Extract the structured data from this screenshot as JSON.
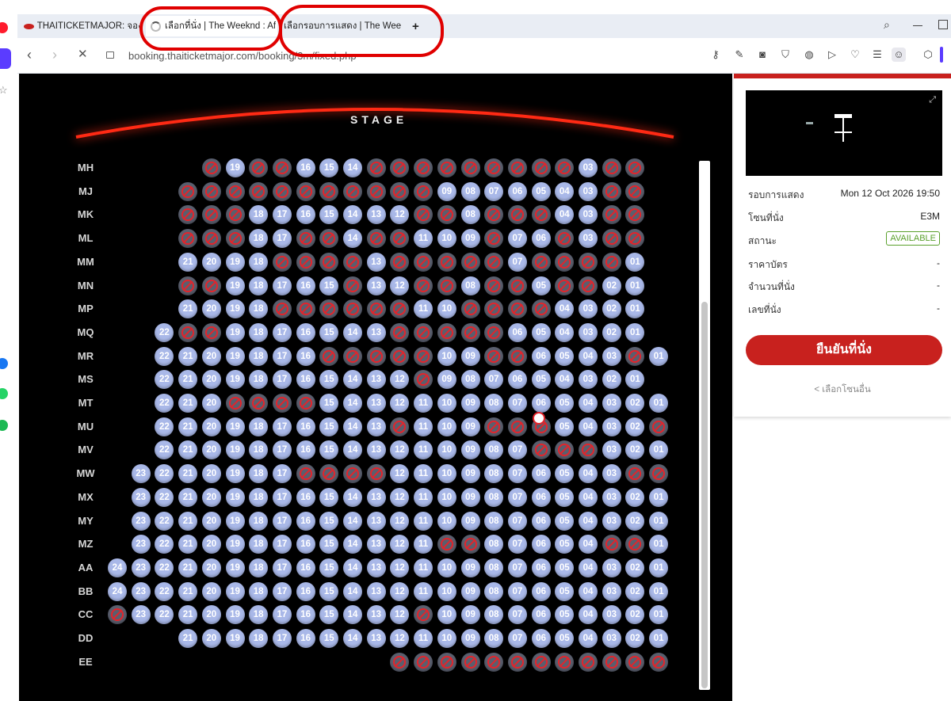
{
  "tabs": [
    {
      "label": "THAITICKETMAJOR: จองตั๋ว",
      "active": false
    },
    {
      "label": "เลือกที่นั่ง | The Weeknd : Af",
      "active": true
    },
    {
      "label": "เลือกรอบการแสดง | The Wee",
      "active": false
    }
  ],
  "new_tab": "+",
  "url": "booking.thaiticketmajor.com/booking/3m/fixed.php",
  "stage_label": "STAGE",
  "rows": [
    {
      "label": "MH",
      "seats": [
        null,
        null,
        null,
        null,
        "X",
        "19",
        "X",
        "X",
        "16",
        "15",
        "14",
        "X",
        "X",
        "X",
        "X",
        "X",
        "X",
        "X",
        "X",
        "X",
        "03",
        "X",
        "X"
      ]
    },
    {
      "label": "MJ",
      "seats": [
        null,
        null,
        null,
        "X",
        "X",
        "X",
        "X",
        "X",
        "X",
        "X",
        "X",
        "X",
        "X",
        "X",
        "09",
        "08",
        "07",
        "06",
        "05",
        "04",
        "03",
        "X",
        "X"
      ]
    },
    {
      "label": "MK",
      "seats": [
        null,
        null,
        null,
        "X",
        "X",
        "X",
        "18",
        "17",
        "16",
        "15",
        "14",
        "13",
        "12",
        "X",
        "X",
        "08",
        "X",
        "X",
        "X",
        "04",
        "03",
        "X",
        "X"
      ]
    },
    {
      "label": "ML",
      "seats": [
        null,
        null,
        null,
        "X",
        "X",
        "X",
        "18",
        "17",
        "X",
        "X",
        "14",
        "X",
        "X",
        "11",
        "10",
        "09",
        "X",
        "07",
        "06",
        "X",
        "03",
        "X",
        "X"
      ]
    },
    {
      "label": "MM",
      "seats": [
        null,
        null,
        null,
        "21",
        "20",
        "19",
        "18",
        "X",
        "X",
        "X",
        "X",
        "13",
        "X",
        "X",
        "X",
        "X",
        "X",
        "07",
        "X",
        "X",
        "X",
        "X",
        "01"
      ]
    },
    {
      "label": "MN",
      "seats": [
        null,
        null,
        null,
        "X",
        "X",
        "19",
        "18",
        "17",
        "16",
        "15",
        "X",
        "13",
        "12",
        "X",
        "X",
        "08",
        "X",
        "X",
        "05",
        "X",
        "X",
        "02",
        "01"
      ]
    },
    {
      "label": "MP",
      "seats": [
        null,
        null,
        null,
        "21",
        "20",
        "19",
        "18",
        "X",
        "X",
        "X",
        "X",
        "X",
        "X",
        "11",
        "10",
        "X",
        "X",
        "X",
        "X",
        "04",
        "03",
        "02",
        "01"
      ]
    },
    {
      "label": "MQ",
      "seats": [
        null,
        null,
        "22",
        "X",
        "X",
        "19",
        "18",
        "17",
        "16",
        "15",
        "14",
        "13",
        "X",
        "X",
        "X",
        "X",
        "X",
        "06",
        "05",
        "04",
        "03",
        "02",
        "01"
      ]
    },
    {
      "label": "MR",
      "seats": [
        null,
        null,
        "22",
        "21",
        "20",
        "19",
        "18",
        "17",
        "16",
        "X",
        "X",
        "X",
        "X",
        "X",
        "10",
        "09",
        "X",
        "X",
        "06",
        "05",
        "04",
        "03",
        "X",
        "01"
      ]
    },
    {
      "label": "MS",
      "seats": [
        null,
        null,
        "22",
        "21",
        "20",
        "19",
        "18",
        "17",
        "16",
        "15",
        "14",
        "13",
        "12",
        "X",
        "09",
        "08",
        "07",
        "06",
        "05",
        "04",
        "03",
        "02",
        "01"
      ]
    },
    {
      "label": "MT",
      "seats": [
        null,
        null,
        "22",
        "21",
        "20",
        "X",
        "X",
        "X",
        "X",
        "15",
        "14",
        "13",
        "12",
        "11",
        "10",
        "09",
        "08",
        "07",
        "06",
        "05",
        "04",
        "03",
        "02",
        "01"
      ]
    },
    {
      "label": "MU",
      "seats": [
        null,
        null,
        "22",
        "21",
        "20",
        "19",
        "18",
        "17",
        "16",
        "15",
        "14",
        "13",
        "X",
        "11",
        "10",
        "09",
        "X",
        "X",
        "X",
        "05",
        "04",
        "03",
        "02",
        "X"
      ]
    },
    {
      "label": "MV",
      "seats": [
        null,
        null,
        "22",
        "21",
        "20",
        "19",
        "18",
        "17",
        "16",
        "15",
        "14",
        "13",
        "12",
        "11",
        "10",
        "09",
        "08",
        "07",
        "X",
        "X",
        "X",
        "03",
        "02",
        "01"
      ]
    },
    {
      "label": "MW",
      "seats": [
        null,
        "23",
        "22",
        "21",
        "20",
        "19",
        "18",
        "17",
        "X",
        "X",
        "X",
        "X",
        "12",
        "11",
        "10",
        "09",
        "08",
        "07",
        "06",
        "05",
        "04",
        "03",
        "X",
        "X"
      ]
    },
    {
      "label": "MX",
      "seats": [
        null,
        "23",
        "22",
        "21",
        "20",
        "19",
        "18",
        "17",
        "16",
        "15",
        "14",
        "13",
        "12",
        "11",
        "10",
        "09",
        "08",
        "07",
        "06",
        "05",
        "04",
        "03",
        "02",
        "01"
      ]
    },
    {
      "label": "MY",
      "seats": [
        null,
        "23",
        "22",
        "21",
        "20",
        "19",
        "18",
        "17",
        "16",
        "15",
        "14",
        "13",
        "12",
        "11",
        "10",
        "09",
        "08",
        "07",
        "06",
        "05",
        "04",
        "03",
        "02",
        "01"
      ]
    },
    {
      "label": "MZ",
      "seats": [
        null,
        "23",
        "22",
        "21",
        "20",
        "19",
        "18",
        "17",
        "16",
        "15",
        "14",
        "13",
        "12",
        "11",
        "X",
        "X",
        "08",
        "07",
        "06",
        "05",
        "04",
        "X",
        "X",
        "01"
      ]
    },
    {
      "label": "AA",
      "seats": [
        "24",
        "23",
        "22",
        "21",
        "20",
        "19",
        "18",
        "17",
        "16",
        "15",
        "14",
        "13",
        "12",
        "11",
        "10",
        "09",
        "08",
        "07",
        "06",
        "05",
        "04",
        "03",
        "02",
        "01"
      ]
    },
    {
      "label": "BB",
      "seats": [
        "24",
        "23",
        "22",
        "21",
        "20",
        "19",
        "18",
        "17",
        "16",
        "15",
        "14",
        "13",
        "12",
        "11",
        "10",
        "09",
        "08",
        "07",
        "06",
        "05",
        "04",
        "03",
        "02",
        "01"
      ]
    },
    {
      "label": "CC",
      "seats": [
        "X",
        "23",
        "22",
        "21",
        "20",
        "19",
        "18",
        "17",
        "16",
        "15",
        "14",
        "13",
        "12",
        "X",
        "10",
        "09",
        "08",
        "07",
        "06",
        "05",
        "04",
        "03",
        "02",
        "01"
      ]
    },
    {
      "label": "DD",
      "seats": [
        null,
        null,
        null,
        "21",
        "20",
        "19",
        "18",
        "17",
        "16",
        "15",
        "14",
        "13",
        "12",
        "11",
        "10",
        "09",
        "08",
        "07",
        "06",
        "05",
        "04",
        "03",
        "02",
        "01"
      ]
    },
    {
      "label": "EE",
      "seats": [
        null,
        null,
        null,
        null,
        null,
        null,
        null,
        null,
        null,
        null,
        null,
        null,
        "X",
        "X",
        "X",
        "X",
        "X",
        "X",
        "X",
        "X",
        "X",
        "X",
        "X",
        "X"
      ]
    }
  ],
  "panel": {
    "round_label": "รอบการแสดง",
    "round_value": "Mon 12 Oct 2026 19:50",
    "zone_label": "โซนที่นั่ง",
    "zone_value": "E3M",
    "status_label": "สถานะ",
    "status_value": "AVAILABLE",
    "price_label": "ราคาบัตร",
    "price_value": "-",
    "qty_label": "จำนวนที่นั่ง",
    "qty_value": "-",
    "seatno_label": "เลขที่นั่ง",
    "seatno_value": "-",
    "confirm_button": "ยืนยันที่นั่ง",
    "other_zone_link": "< เลือกโซนอื่น"
  },
  "colors": {
    "seat_available": "#a9b8e8",
    "seat_booked": "#5a5f6e",
    "brand_red": "#c8211e",
    "available_green": "#5aa02c"
  }
}
